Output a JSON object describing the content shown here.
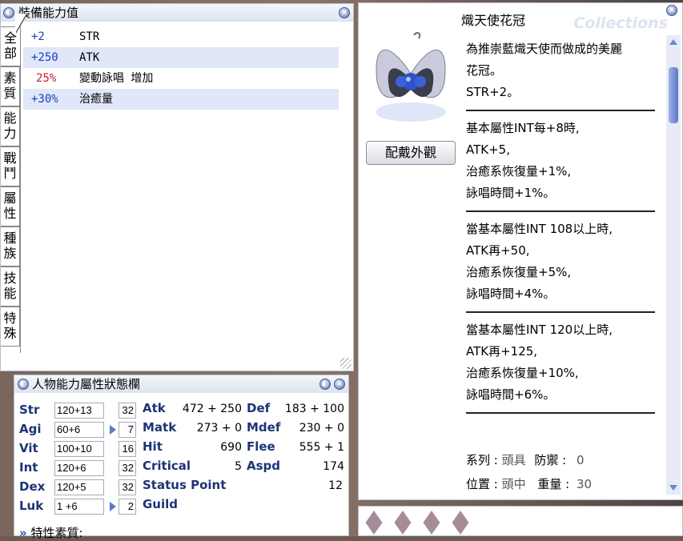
{
  "equip_window": {
    "title": "裝備能力值",
    "tabs": [
      "全部",
      "素質",
      "能力",
      "戰鬥",
      "屬性",
      "種族",
      "技能",
      "特殊"
    ],
    "rows": [
      {
        "value": "+2",
        "name": "STR",
        "color": "#1d3cc0"
      },
      {
        "value": "+250",
        "name": "ATK",
        "color": "#1d3cc0"
      },
      {
        "value": "25%",
        "name": "變動詠唱 增加",
        "color": "#d0192b"
      },
      {
        "value": "+30%",
        "name": "治癒量",
        "color": "#1d3cc0"
      }
    ]
  },
  "item_window": {
    "name": "熾天使花冠",
    "watermark": "Collections",
    "equip_look_button": "配戴外觀",
    "description_blocks": [
      [
        "為推崇藍熾天使而做成的美麗",
        "花冠。",
        "STR+2。"
      ],
      [
        "基本屬性INT每+8時,",
        "ATK+5,",
        "治癒系恢復量+1%,",
        "詠唱時間+1%。"
      ],
      [
        "當基本屬性INT 108以上時,",
        "ATK再+50,",
        "治癒系恢復量+5%,",
        "詠唱時間+4%。"
      ],
      [
        "當基本屬性INT 120以上時,",
        "ATK再+125,",
        "治癒系恢復量+10%,",
        "詠唱時間+6%。"
      ]
    ],
    "footer": {
      "type_label": "系列 :",
      "type_value": "頭具",
      "def_label": "防禦 :",
      "def_value": "0",
      "pos_label": "位置 :",
      "pos_value": "頭中",
      "weight_label": "重量 :",
      "weight_value": "30"
    }
  },
  "status_window": {
    "title": "人物能力屬性狀態欄",
    "base_stats": [
      {
        "label": "Str",
        "value": "120+13",
        "cost": "32",
        "arrow": false
      },
      {
        "label": "Agi",
        "value": "60+6",
        "cost": "7",
        "arrow": true
      },
      {
        "label": "Vit",
        "value": "100+10",
        "cost": "16",
        "arrow": false
      },
      {
        "label": "Int",
        "value": "120+6",
        "cost": "32",
        "arrow": false
      },
      {
        "label": "Dex",
        "value": "120+5",
        "cost": "32",
        "arrow": false
      },
      {
        "label": "Luk",
        "value": "1 +6",
        "cost": "2",
        "arrow": true
      }
    ],
    "combat_left": [
      {
        "label": "Atk",
        "value": "472 + 250"
      },
      {
        "label": "Matk",
        "value": "273 + 0"
      },
      {
        "label": "Hit",
        "value": "690"
      },
      {
        "label": "Critical",
        "value": "5"
      },
      {
        "label": "Status Point",
        "value": "12"
      },
      {
        "label": "Guild",
        "value": ""
      }
    ],
    "combat_right": [
      {
        "label": "Def",
        "value": "183 + 100"
      },
      {
        "label": "Mdef",
        "value": "230 + 0"
      },
      {
        "label": "Flee",
        "value": "555 + 1"
      },
      {
        "label": "Aspd",
        "value": "174"
      }
    ],
    "trait_label": "特性素質:"
  }
}
